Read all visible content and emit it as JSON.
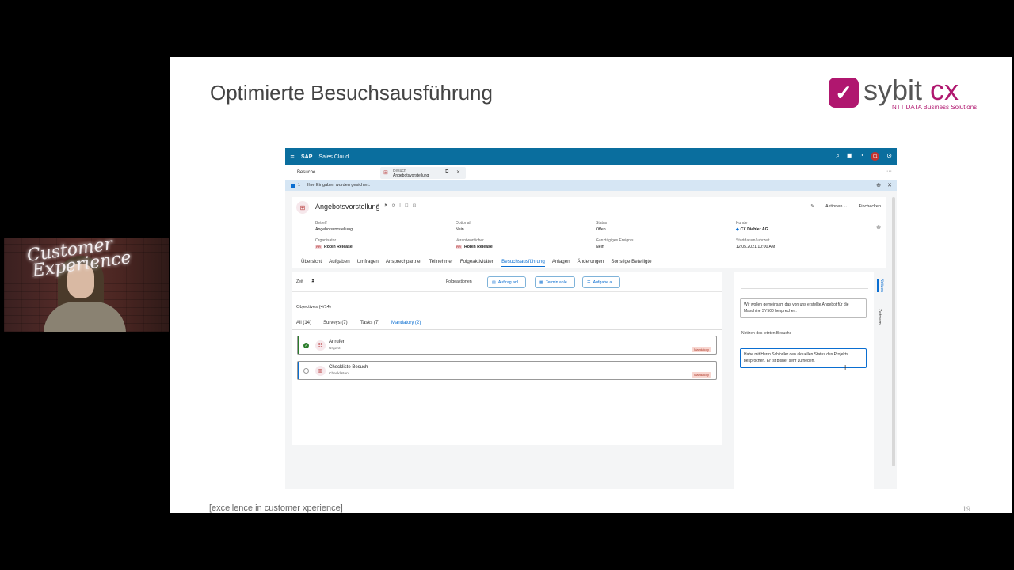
{
  "presenter": {
    "neon_line1": "Customer",
    "neon_line2": "Experience"
  },
  "slide": {
    "title": "Optimierte Besuchsausführung",
    "logo_word": "sybit",
    "logo_cx": "cx",
    "logo_sub": "NTT DATA Business Solutions",
    "footer": "[excellence in customer xperience]",
    "page_number": "19"
  },
  "shell": {
    "menu_glyph": "≡",
    "brand": "SAP",
    "product": "Sales Cloud",
    "avatar_initials": "01",
    "icons": [
      "search-icon",
      "chat-icon",
      "bell-icon",
      "help-icon"
    ]
  },
  "tabs": {
    "besuche": "Besuche",
    "open_tab_type": "Besuch",
    "open_tab_title": "Angebotsvorstellung"
  },
  "message": {
    "count": "1",
    "text": "Ihre Eingaben wurden gesichert."
  },
  "object": {
    "title": "Angebotsvorstellung",
    "actions": "Aktionen ⌄",
    "check_in": "Einchecken",
    "fields": {
      "betreff_label": "Betreff",
      "betreff_value": "Angebotsvorstellung",
      "optional_label": "Optional",
      "optional_value": "Nein",
      "status_label": "Status",
      "status_value": "Offen",
      "kunde_label": "Kunde",
      "kunde_value": "CX Diehler AG",
      "organisator_label": "Organisator",
      "organisator_initials": "RR",
      "organisator_value": "Robin Release",
      "verantwortlicher_label": "Verantwortlicher",
      "verantwortlicher_initials": "RR",
      "verantwortlicher_value": "Robin Release",
      "ganztag_label": "Ganztägiges Ereignis",
      "ganztag_value": "Nein",
      "start_label": "Startdatum/-uhrzeit",
      "start_value": "12.05.2021 10:00 AM"
    }
  },
  "navtabs": [
    "Übersicht",
    "Aufgaben",
    "Umfragen",
    "Ansprechpartner",
    "Teilnehmer",
    "Folgeaktivitäten",
    "Besuchsausführung",
    "Anlagen",
    "Änderungen",
    "Sonstige Beteiligte"
  ],
  "active_navtab": "Besuchsausführung",
  "toolbar": {
    "zeit": "Zeit",
    "folgeaktionen": "Folgeaktionen",
    "btn_auftrag": "Auftrag anl...",
    "btn_termin": "Termin anle...",
    "btn_aufgabe": "Aufgabe a..."
  },
  "objectives": {
    "count": "Objectives (4/14)",
    "filters": {
      "all": "All (14)",
      "surveys": "Surveys (7)",
      "tasks": "Tasks (7)",
      "mandatory": "Mandatory (2)"
    },
    "items": [
      {
        "name": "Anrufen",
        "sub": "Urgent",
        "badge": "Mandatory",
        "done": true
      },
      {
        "name": "Checkliste Besuch",
        "sub": "Checklisten",
        "badge": "Mandatory",
        "done": false
      }
    ]
  },
  "notes": {
    "note1": "Wir wollen gemeinsam das von uns erstellte Angebot für die Maschine SY500 besprechen.",
    "last_label": "Notizen des letzten Besuchs",
    "note2": "Habe mit Herrn Schindler den aktuellen Status des Projekts besprochen. Er ist bisher sehr zufrieden.",
    "vtab1": "Notizen",
    "vtab2": "Zeitraum"
  },
  "colors": {
    "shell": "#0a6e9e",
    "accent": "#0a6ed1",
    "brand": "#b0176f"
  }
}
